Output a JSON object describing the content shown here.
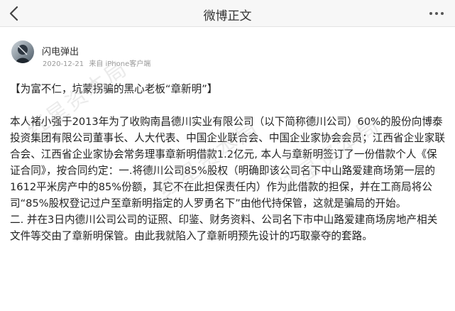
{
  "nav": {
    "title": "微博正文",
    "back_icon": "chevron-left-icon",
    "more_icon": "more-dots-icon"
  },
  "author": {
    "name": "闪电弹出",
    "date": "2020-12-21",
    "source": "来自 iPhone客户端"
  },
  "post": {
    "title": "【为富不仁，坑蒙拐骗的黑心老板“章新明”】",
    "paragraph1": "本人褚小强于2013年为了收购南昌德川实业有限公司（以下简称德川公司）60%的股份向博泰投资集团有限公司董事长、人大代表、中国企业联合会、中国企业家协会会员；江西省企业家联合会、江西省企业家协会常务理事章新明借款1.2亿元, 本人与章新明签订了一份借款个人《保证合同》，按合同约定：一.将德川公司85%股权（明确即该公司名下中山路爱建商场第一层的1612平米房产中的85%份额，其它不在此担保责任内）作为此借款的担保，并在工商局将公司“85%股权登记过户至章新明指定的人罗勇名下”由他代持保管，这就是骗局的开始。",
    "paragraph2": "二. 并在3日内德川公司公司的证照、印鉴、财务资料、公司名下市中山路爱建商场房地产相关文件等交由了章新明保管。由此我就陷入了章新明预先设计的巧取豪夺的套路。"
  },
  "watermark": {
    "text": "红星资本局"
  },
  "colors": {
    "navbar_bg": "#f7f7f7",
    "text": "#222222",
    "meta": "#999999"
  }
}
